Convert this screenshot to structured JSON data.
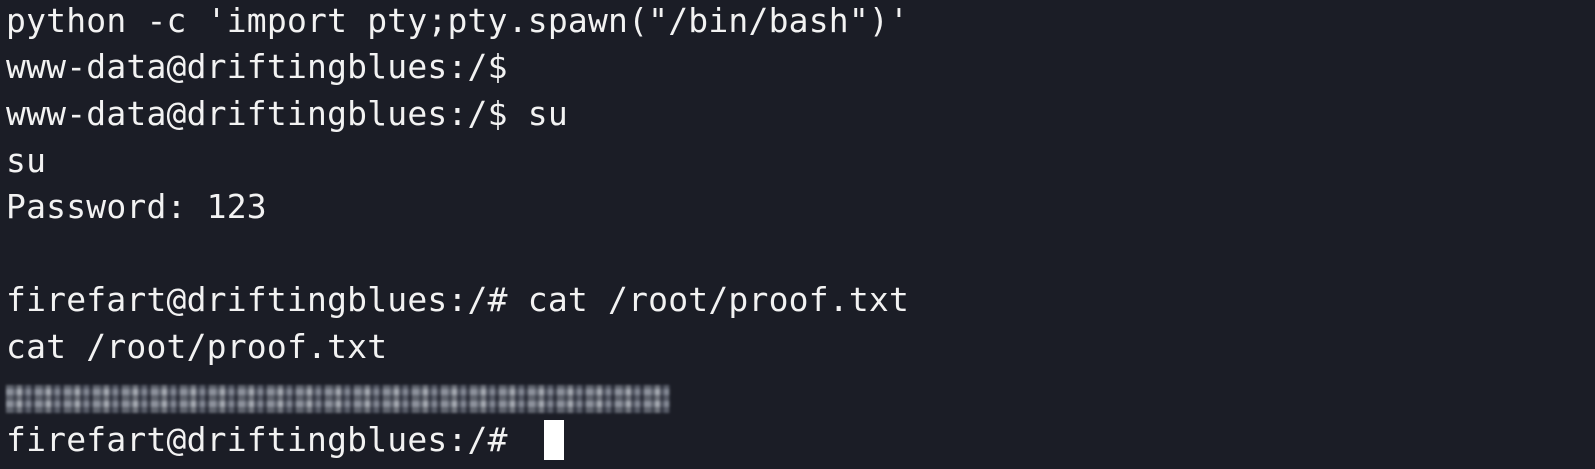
{
  "terminal": {
    "lines": [
      "python -c 'import pty;pty.spawn(\"/bin/bash\")'",
      "www-data@driftingblues:/$",
      "www-data@driftingblues:/$ su",
      "su",
      "Password: 123",
      "",
      "firefart@driftingblues:/# cat /root/proof.txt",
      "cat /root/proof.txt",
      "firefart@driftingblues:/# "
    ],
    "colors": {
      "background": "#1b1d26",
      "foreground": "#f2f2f2",
      "cursor": "#ffffff"
    }
  }
}
